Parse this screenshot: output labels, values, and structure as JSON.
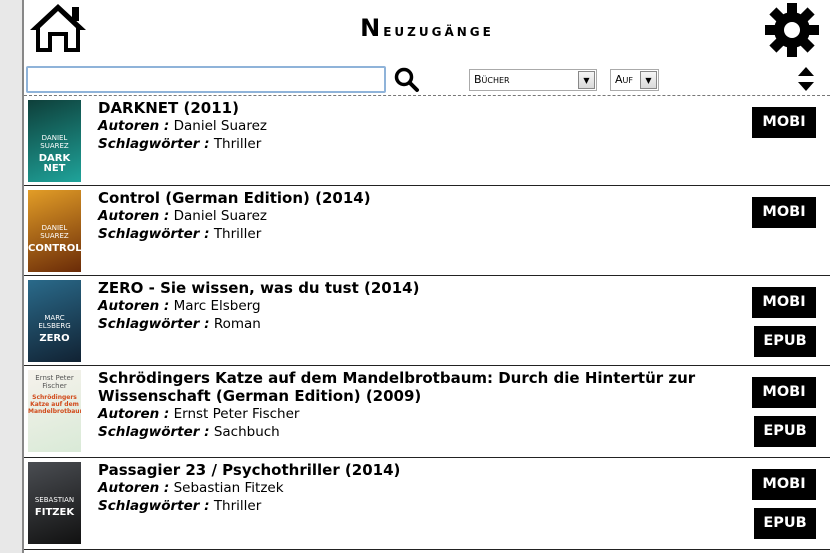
{
  "header": {
    "title_first": "N",
    "title_rest": "euzugänge",
    "home_icon": "home-icon",
    "settings_icon": "gear-icon"
  },
  "toolbar": {
    "search_value": "",
    "search_icon": "search-icon",
    "type_select": "Bücher",
    "order_select": "Auf",
    "sort_icon": "sort-updown-icon"
  },
  "labels": {
    "authors": "Autoren :",
    "tags": "Schlagwörter :"
  },
  "books": [
    {
      "title": "DARKNET (2011)",
      "authors": "Daniel Suarez",
      "tags": "Thriller",
      "formats": [
        "MOBI"
      ],
      "cover": {
        "top_text": "DANIEL\nSUAREZ",
        "big_text": "DARK NET",
        "c1": "#0e3f3a",
        "c2": "#1fa39a"
      }
    },
    {
      "title": "Control (German Edition) (2014)",
      "authors": "Daniel Suarez",
      "tags": "Thriller",
      "formats": [
        "MOBI"
      ],
      "cover": {
        "top_text": "DANIEL\nSUAREZ",
        "big_text": "CONTROL",
        "c1": "#e29d27",
        "c2": "#6a2b08"
      }
    },
    {
      "title": "ZERO - Sie wissen, was du tust (2014)",
      "authors": "Marc Elsberg",
      "tags": "Roman",
      "formats": [
        "MOBI",
        "EPUB"
      ],
      "cover": {
        "top_text": "MARC ELSBERG",
        "big_text": "ZERO",
        "c1": "#2a6a8a",
        "c2": "#112233"
      }
    },
    {
      "title": "Schrödingers Katze auf dem Mandelbrotbaum: Durch die Hintertür zur Wissenschaft (German Edition) (2009)",
      "authors": "Ernst Peter Fischer",
      "tags": "Sachbuch",
      "formats": [
        "MOBI",
        "EPUB"
      ],
      "cover": {
        "top_text": "Ernst Peter Fischer",
        "big_text": "Schrödingers Katze auf dem Mandelbrotbaum",
        "c1": "#f6f2ec",
        "c2": "#d9ead7"
      }
    },
    {
      "title": "Passagier 23 / Psychothriller (2014)",
      "authors": "Sebastian Fitzek",
      "tags": "Thriller",
      "formats": [
        "MOBI",
        "EPUB"
      ],
      "cover": {
        "top_text": "SEBASTIAN",
        "big_text": "FITZEK",
        "c1": "#4a4d52",
        "c2": "#111"
      }
    }
  ]
}
